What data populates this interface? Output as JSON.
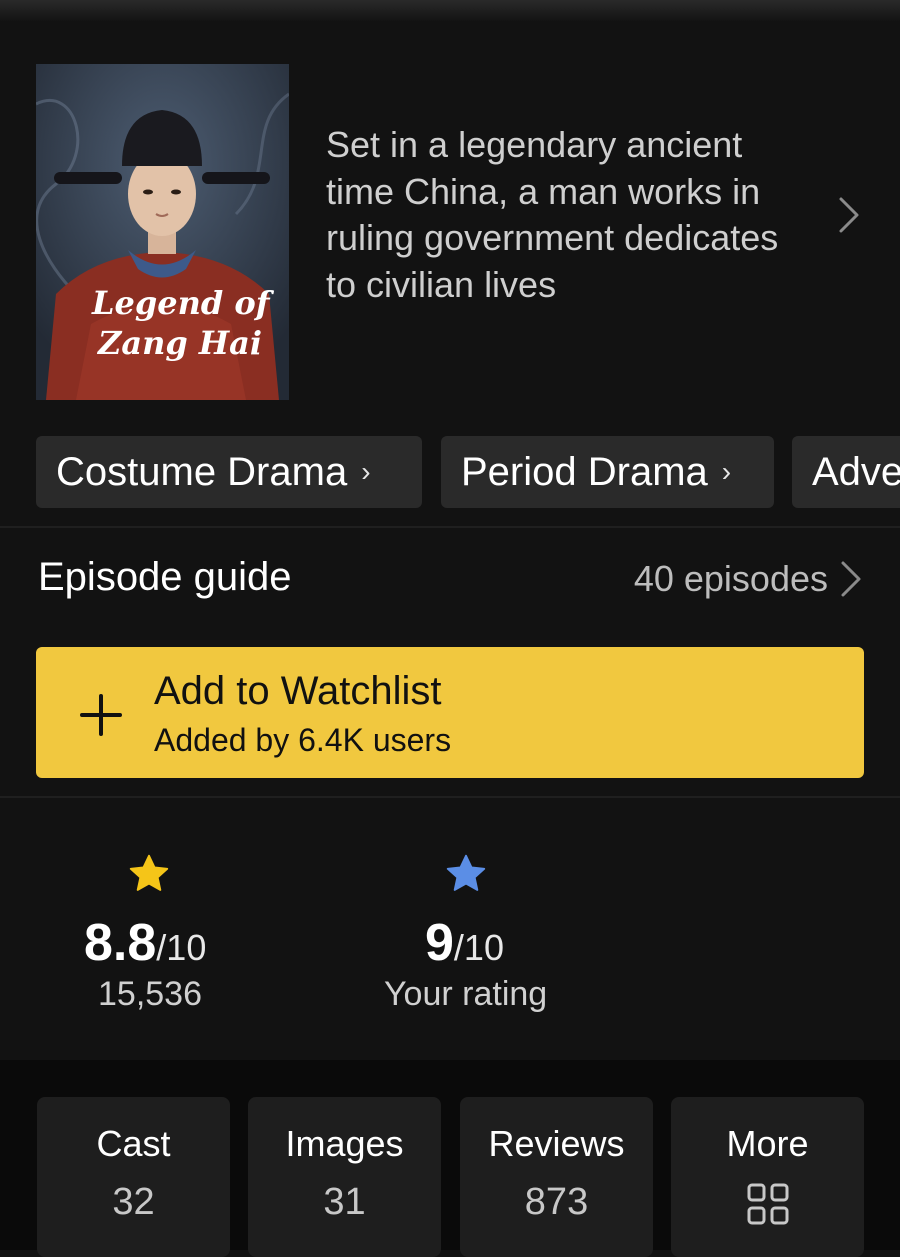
{
  "poster": {
    "title_line1": "Legend of",
    "title_line2": "Zang Hai"
  },
  "synopsis": {
    "text": "Set in a legendary ancient time China, a man works in ruling government dedicates to civilian lives"
  },
  "genres": [
    {
      "label": "Costume Drama"
    },
    {
      "label": "Period Drama"
    },
    {
      "label": "Adve"
    }
  ],
  "episode_guide": {
    "title": "Episode guide",
    "count": "40 episodes"
  },
  "watchlist": {
    "label": "Add to Watchlist",
    "subtitle": "Added by 6.4K users"
  },
  "ratings": {
    "imdb": {
      "value": "8.8",
      "out_of": "/10",
      "count": "15,536",
      "star_color": "#f5c518"
    },
    "user": {
      "value": "9",
      "out_of": "/10",
      "label": "Your rating",
      "star_color": "#5b8ee6"
    }
  },
  "tiles": [
    {
      "label": "Cast",
      "count": "32"
    },
    {
      "label": "Images",
      "count": "31"
    },
    {
      "label": "Reviews",
      "count": "873"
    },
    {
      "label": "More",
      "icon": "grid-icon"
    }
  ],
  "colors": {
    "background": "#121212",
    "accent": "#f1c83f"
  }
}
